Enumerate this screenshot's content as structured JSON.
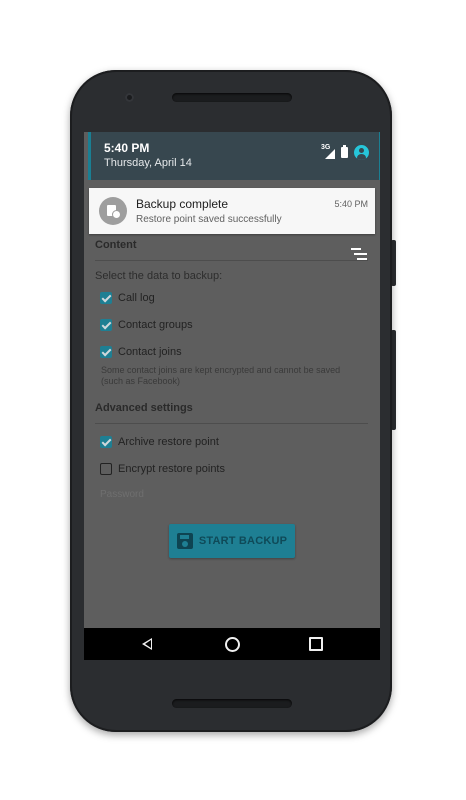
{
  "status_shade": {
    "time": "5:40 PM",
    "date": "Thursday, April 14",
    "network_label": "3G",
    "icons": [
      "network-3g-icon",
      "battery-icon",
      "account-icon"
    ]
  },
  "notification": {
    "icon": "backup-icon",
    "title": "Backup complete",
    "text": "Restore point saved successfully",
    "time": "5:40 PM"
  },
  "content_section": {
    "title": "Content",
    "collapse_icon": "collapse-icon",
    "prompt": "Select the data to backup:",
    "options": [
      {
        "label": "Call log",
        "checked": true
      },
      {
        "label": "Contact groups",
        "checked": true
      },
      {
        "label": "Contact joins",
        "checked": true
      }
    ],
    "note": "Some contact joins are kept encrypted and cannot be saved (such as Facebook)"
  },
  "advanced_section": {
    "title": "Advanced settings",
    "options": [
      {
        "label": "Archive restore point",
        "checked": true
      },
      {
        "label": "Encrypt restore points",
        "checked": false
      }
    ],
    "password_placeholder": "Password"
  },
  "start_button": {
    "label": "START BACKUP",
    "icon": "save-icon"
  },
  "colors": {
    "accent": "#1e7f93",
    "shade": "#37474f",
    "screen_dim": "#5e5e5e"
  },
  "nav_bar": {
    "buttons": [
      "back-icon",
      "home-icon",
      "recents-icon"
    ]
  }
}
